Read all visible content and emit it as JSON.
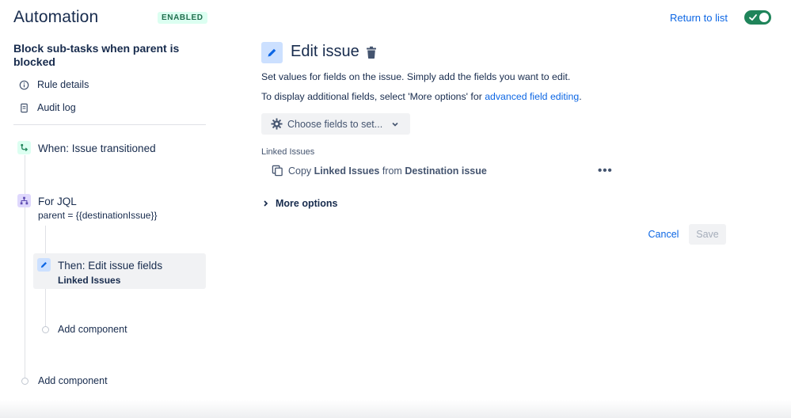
{
  "header": {
    "title": "Automation",
    "status_badge": "ENABLED",
    "return_link": "Return to list",
    "toggle_state": "on",
    "accent_color": "#1F845A"
  },
  "sidebar": {
    "rule_name": "Block sub-tasks when parent is blocked",
    "links": [
      {
        "label": "Rule details",
        "icon": "info-icon"
      },
      {
        "label": "Audit log",
        "icon": "document-icon"
      }
    ],
    "components": [
      {
        "title": "When: Issue transitioned",
        "icon": "transition-icon",
        "icon_color": "#1F845A"
      },
      {
        "title": "For JQL",
        "subtitle": "parent = {{destinationIssue}}",
        "icon": "branch-icon",
        "icon_color": "#5E4DB2"
      },
      {
        "title": "Then: Edit issue fields",
        "subtitle": "Linked Issues",
        "icon": "pencil-icon",
        "icon_color": "#0C66E4",
        "selected": true
      }
    ],
    "add_component_nested": "Add component",
    "add_component_root": "Add component"
  },
  "main": {
    "title": "Edit issue",
    "description_1": "Set values for fields on the issue. Simply add the fields you want to edit.",
    "description_2_prefix": "To display additional fields, select 'More options' for ",
    "description_2_link": "advanced field editing",
    "description_2_suffix": ".",
    "choose_fields_label": "Choose fields to set...",
    "field_section_label": "Linked Issues",
    "copy_row": {
      "prefix": "Copy",
      "field": "Linked Issues",
      "middle": "from",
      "source": "Destination issue"
    },
    "more_options_label": "More options",
    "cancel_label": "Cancel",
    "save_label": "Save"
  }
}
